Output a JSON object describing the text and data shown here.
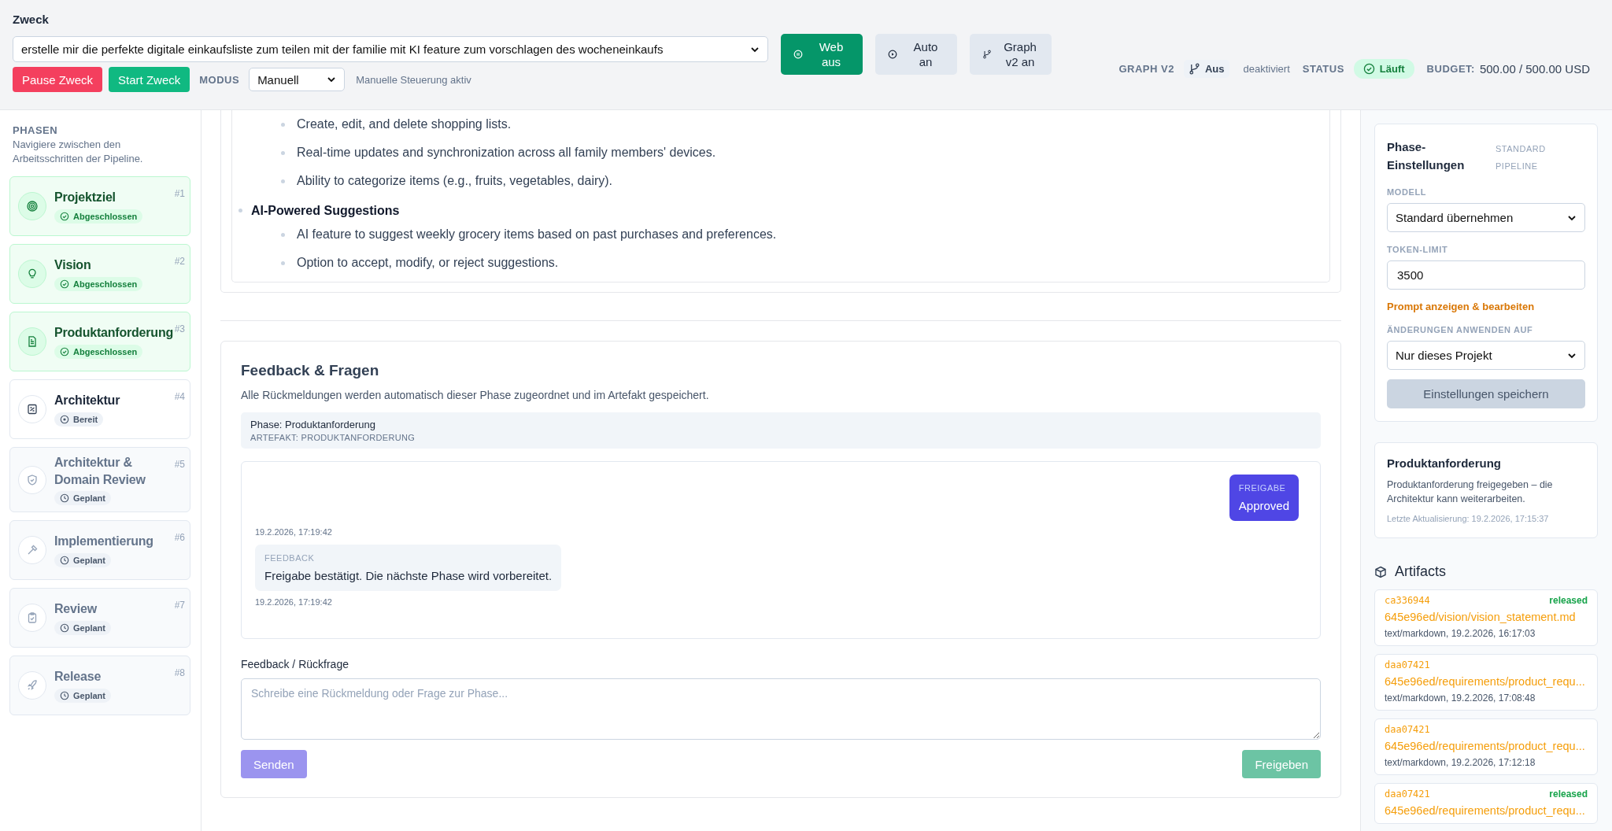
{
  "header": {
    "purpose_label": "Zweck",
    "purpose_value": "erstelle mir die perfekte digitale einkaufsliste zum teilen mit der familie mit KI feature zum vorschlagen des wocheneinkaufs",
    "toggles": [
      {
        "label": "Web aus",
        "on": true
      },
      {
        "label": "Auto an",
        "on": false
      },
      {
        "label": "Graph v2 an",
        "on": false
      }
    ],
    "actions": [
      {
        "label": "Pause Zweck",
        "kind": "danger"
      },
      {
        "label": "Start Zweck",
        "kind": "success"
      }
    ],
    "mode_label": "MODUS",
    "mode_value": "Manuell",
    "mode_hint": "Manuelle Steuerung aktiv",
    "graph_label": "GRAPH V2",
    "graph_value": "Aus",
    "graph_state": "deaktiviert",
    "status_label": "STATUS",
    "status_value": "Läuft",
    "budget_label": "BUDGET:",
    "budget_value": "500.00 / 500.00 USD"
  },
  "sidebar": {
    "title": "PHASEN",
    "subtitle": "Navigiere zwischen den Arbeitsschritten der Pipeline.",
    "phases": [
      {
        "name": "Projektziel",
        "number": "#1",
        "status": "Abgeschlossen",
        "kind": "done"
      },
      {
        "name": "Vision",
        "number": "#2",
        "status": "Abgeschlossen",
        "kind": "done"
      },
      {
        "name": "Produktanforderung",
        "number": "#3",
        "status": "Abgeschlossen",
        "kind": "done"
      },
      {
        "name": "Architektur",
        "number": "#4",
        "status": "Bereit",
        "kind": "ready"
      },
      {
        "name": "Architektur & Domain Review",
        "number": "#5",
        "status": "Geplant",
        "kind": "planned"
      },
      {
        "name": "Implementierung",
        "number": "#6",
        "status": "Geplant",
        "kind": "planned"
      },
      {
        "name": "Review",
        "number": "#7",
        "status": "Geplant",
        "kind": "planned"
      },
      {
        "name": "Release",
        "number": "#8",
        "status": "Geplant",
        "kind": "planned"
      }
    ]
  },
  "document": {
    "items": [
      {
        "children": [
          {
            "text": "Create, edit, and delete shopping lists."
          },
          {
            "text": "Real-time updates and synchronization across all family members' devices."
          },
          {
            "text": "Ability to categorize items (e.g., fruits, vegetables, dairy)."
          }
        ]
      },
      {
        "text": "AI-Powered Suggestions",
        "children": [
          {
            "text": "AI feature to suggest weekly grocery items based on past purchases and preferences."
          },
          {
            "text": "Option to accept, modify, or reject suggestions."
          }
        ]
      }
    ]
  },
  "feedback": {
    "title": "Feedback & Fragen",
    "description": "Alle Rückmeldungen werden automatisch dieser Phase zugeordnet und im Artefakt gespeichert.",
    "phase_line": "Phase: Produktanforderung",
    "artifact_line": "ARTEFAKT: PRODUKTANFORDERUNG",
    "messages": [
      {
        "kind": "user",
        "label": "FREIGABE",
        "text": "Approved",
        "time": "19.2.2026, 17:19:42"
      },
      {
        "kind": "system",
        "label": "FEEDBACK",
        "text": "Freigabe bestätigt. Die nächste Phase wird vorbereitet.",
        "time": "19.2.2026, 17:19:42"
      }
    ],
    "input_label": "Feedback / Rückfrage",
    "placeholder": "Schreibe eine Rückmeldung oder Frage zur Phase...",
    "send": {
      "label": "Senden",
      "disabled": true
    },
    "approve": {
      "label": "Freigeben",
      "disabled": true
    }
  },
  "settings": {
    "title": "Phase-Einstellungen",
    "scope": "STANDARD PIPELINE",
    "model_label": "MODELL",
    "model_value": "Standard übernehmen",
    "token_label": "TOKEN-LIMIT",
    "token_value": "3500",
    "prompt_link": "Prompt anzeigen & bearbeiten",
    "apply_label": "ÄNDERUNGEN ANWENDEN AUF",
    "apply_value": "Nur dieses Projekt",
    "save": {
      "label": "Einstellungen speichern",
      "disabled": true
    }
  },
  "phase_info": {
    "title": "Produktanforderung",
    "text": "Produktanforderung freigegeben – die Architektur kann weiterarbeiten.",
    "updated": "Letzte Aktualisierung: 19.2.2026, 17:15:37"
  },
  "artifacts": {
    "title": "Artifacts",
    "items": [
      {
        "id": "ca336944",
        "badge": "released",
        "path": "645e96ed/vision/vision_statement.md",
        "meta": "text/markdown, 19.2.2026, 16:17:03"
      },
      {
        "id": "daa07421",
        "path": "645e96ed/requirements/product_requ...",
        "meta": "text/markdown, 19.2.2026, 17:08:48"
      },
      {
        "id": "daa07421",
        "path": "645e96ed/requirements/product_requ...",
        "meta": "text/markdown, 19.2.2026, 17:12:18"
      },
      {
        "id": "daa07421",
        "badge": "released",
        "path": "645e96ed/requirements/product_requ..."
      }
    ]
  }
}
